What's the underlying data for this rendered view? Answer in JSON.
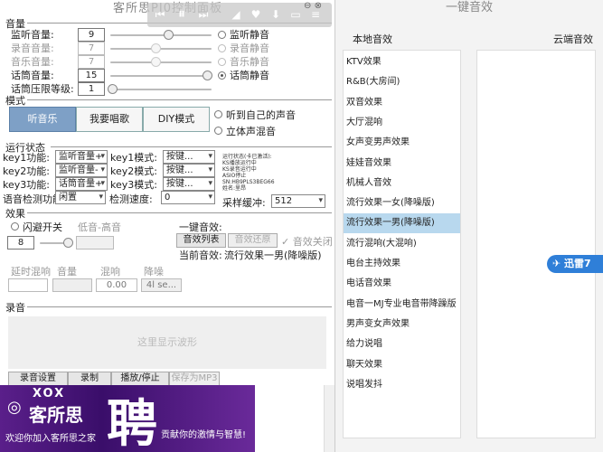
{
  "left_window": {
    "title": "客所思PJ0控制面板",
    "volume_section": "音量",
    "rows": [
      {
        "label": "监听音量:",
        "value": "9",
        "mute_label": "监听静音",
        "enabled": true
      },
      {
        "label": "录音音量:",
        "value": "7",
        "mute_label": "录音静音",
        "enabled": false
      },
      {
        "label": "音乐音量:",
        "value": "7",
        "mute_label": "音乐静音",
        "enabled": false
      },
      {
        "label": "话筒音量:",
        "value": "15",
        "mute_label": "话筒静音",
        "enabled": true
      },
      {
        "label": "话筒压限等级:",
        "value": "1",
        "mute_label": "",
        "enabled": true
      }
    ],
    "mode_section": "模式",
    "mode_buttons": [
      "听音乐",
      "我要唱歌",
      "DIY模式"
    ],
    "mode_options": [
      "听到自己的声音",
      "立体声混音"
    ],
    "run_section": "运行状态",
    "functions": [
      {
        "label": "key1功能:",
        "value": "监听音量+",
        "mode_label": "key1模式:",
        "mode_value": "按键..."
      },
      {
        "label": "key2功能:",
        "value": "监听音量-",
        "mode_label": "key2模式:",
        "mode_value": "按键..."
      },
      {
        "label": "key3功能:",
        "value": "话筒音量+",
        "mode_label": "key3模式:",
        "mode_value": "按键..."
      }
    ],
    "voice_detect": {
      "label": "语音检测功能",
      "value": "闲置",
      "speed_label": "检测速度:",
      "speed_value": "0"
    },
    "status_lines": [
      "运行状态(卡已激活):",
      "KS播放运行中",
      "KS录音运行中",
      "ASIO停止",
      "SN:HB9PLS3BEG66",
      "姓名:里昂"
    ],
    "buffer": {
      "label": "采样缓冲:",
      "value": "512"
    },
    "effects_section": "效果",
    "flash_switch": "闪避开关",
    "low_high": "低音-高音",
    "flash_value": "8",
    "one_key_title": "一键音效:",
    "effect_list_btn": "音效列表",
    "effect_restore_btn": "音效还原",
    "effect_off": "音效关闭",
    "current_effect_label": "当前音效:",
    "current_effect_value": "流行效果一男(降噪版)",
    "reverb_labels": [
      "延时混响",
      "音量",
      "混响",
      "降噪"
    ],
    "reverb_values": [
      "",
      "",
      "0.00",
      "4l se..."
    ],
    "record_section": "录音",
    "waveform_text": "这里显示波形",
    "record_buttons": [
      "录音设置",
      "录制",
      "播放/停止",
      "保存为MP3"
    ],
    "banner": {
      "brand_en": "XOX",
      "brand": "客所思",
      "big": "聘",
      "left_line": "欢迎你加入客所思之家",
      "right_line": "贡献你的激情与智慧!"
    }
  },
  "media_toolbar": {
    "icons": [
      "prev-icon",
      "pause-icon",
      "next-icon",
      "volume-icon",
      "heart-icon",
      "download-icon",
      "comment-icon",
      "menu-icon"
    ]
  },
  "right_window": {
    "title": "一键音效",
    "local_header": "本地音效",
    "cloud_header": "云端音效",
    "local_items": [
      "KTV效果",
      "R&B(大房间)",
      "双音效果",
      "大厅混响",
      "女声变男声效果",
      "娃娃音效果",
      "机械人音效",
      "流行效果一女(降噪版)",
      "流行效果一男(降噪版)",
      "流行混响(大混响)",
      "电台主持效果",
      "电话音效果",
      "电音一MJ专业电音带降躁版",
      "男声变女声效果",
      "给力说唱",
      "聊天效果",
      "说唱发抖"
    ],
    "selected_index": 8,
    "pill_label": "迅雷7"
  },
  "colors": {
    "mode_active": "#7ea0c6",
    "selected_row": "#b8d8ee",
    "banner": "#4a1478"
  }
}
